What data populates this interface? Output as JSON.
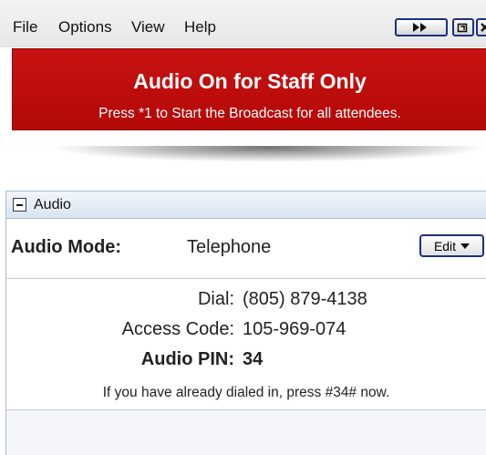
{
  "menubar": {
    "items": [
      "File",
      "Options",
      "View",
      "Help"
    ],
    "window_buttons": [
      {
        "icon": "fast-forward-icon"
      },
      {
        "icon": "restore-icon"
      },
      {
        "icon": "close-icon"
      }
    ]
  },
  "banner": {
    "title": "Audio On for Staff Only",
    "subtitle": "Press *1 to Start the Broadcast for all attendees.",
    "color": "#c00d0d"
  },
  "audio_panel": {
    "title": "Audio",
    "mode_label": "Audio Mode:",
    "mode_value": "Telephone",
    "edit_label": "Edit",
    "dial_label": "Dial:",
    "dial_value": "(805) 879-4138",
    "access_label": "Access Code:",
    "access_value": "105-969-074",
    "pin_label": "Audio PIN:",
    "pin_value": "34",
    "note": "If you have already dialed in, press #34# now."
  }
}
